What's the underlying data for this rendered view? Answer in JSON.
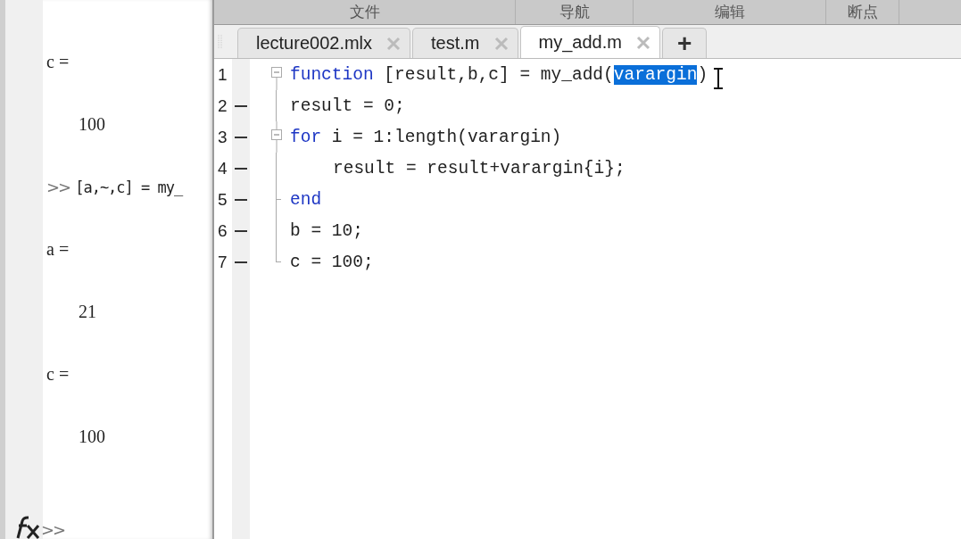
{
  "command_window": {
    "lines": [
      {
        "kind": "output",
        "text": "c ="
      },
      {
        "kind": "value",
        "text": "100"
      },
      {
        "kind": "command",
        "prompt": ">>",
        "text": "[a,~,c] = my_"
      },
      {
        "kind": "output",
        "text": "a ="
      },
      {
        "kind": "value",
        "text": "21"
      },
      {
        "kind": "output",
        "text": "c ="
      },
      {
        "kind": "value",
        "text": "100"
      }
    ],
    "input": {
      "prompt": ">>"
    }
  },
  "editor": {
    "sections": [
      "文件",
      "导航",
      "编辑",
      "断点"
    ],
    "tabs": [
      {
        "label": "lecture002.mlx",
        "selected": false
      },
      {
        "label": "test.m",
        "selected": false
      },
      {
        "label": "my_add.m",
        "selected": true
      }
    ],
    "new_tab": "+",
    "lines": [
      {
        "number": "1",
        "executable": false,
        "kind": "start",
        "indent": false,
        "segments": [
          {
            "kind": "keyword",
            "text": "function"
          },
          {
            "kind": "plain",
            "text": " [result,b,c] = my_add("
          },
          {
            "kind": "selected",
            "text": "varargin"
          },
          {
            "kind": "plain",
            "text": ")"
          }
        ]
      },
      {
        "number": "2",
        "executable": true,
        "kind": "mid",
        "indent": false,
        "segments": [
          {
            "kind": "plain",
            "text": "result = 0;"
          }
        ]
      },
      {
        "number": "3",
        "executable": true,
        "kind": "start",
        "indent": false,
        "segments": [
          {
            "kind": "keyword",
            "text": "for"
          },
          {
            "kind": "plain",
            "text": " i = 1:length(varargin)"
          }
        ]
      },
      {
        "number": "4",
        "executable": true,
        "kind": "mid",
        "indent": true,
        "segments": [
          {
            "kind": "plain",
            "text": "result = result+varargin{i};"
          }
        ]
      },
      {
        "number": "5",
        "executable": true,
        "kind": "tick",
        "indent": false,
        "segments": [
          {
            "kind": "keyword",
            "text": "end"
          }
        ]
      },
      {
        "number": "6",
        "executable": true,
        "kind": "mid",
        "indent": false,
        "segments": [
          {
            "kind": "plain",
            "text": "b = 10;"
          }
        ]
      },
      {
        "number": "7",
        "executable": true,
        "kind": "end",
        "indent": false,
        "segments": [
          {
            "kind": "plain",
            "text": "c = 100;"
          }
        ]
      }
    ]
  }
}
